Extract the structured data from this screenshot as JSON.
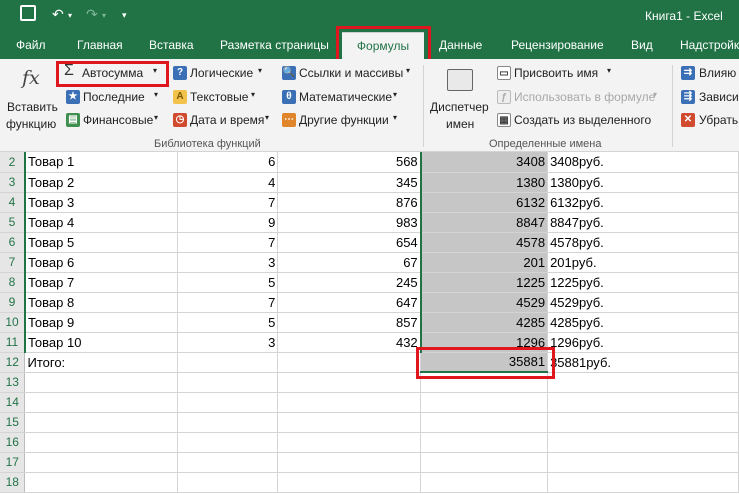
{
  "window": {
    "title": "Книга1 - Excel"
  },
  "tabs": [
    "Файл",
    "Главная",
    "Вставка",
    "Разметка страницы",
    "Формулы",
    "Данные",
    "Рецензирование",
    "Вид",
    "Надстройк"
  ],
  "active_tab": "Формулы",
  "ribbon": {
    "insert_function": {
      "icon": "fx",
      "line1": "Вставить",
      "line2": "функцию"
    },
    "library": {
      "autosum": "Автосумма",
      "recent": "Последние",
      "financial": "Финансовые",
      "logical": "Логические",
      "text": "Текстовые",
      "datetime": "Дата и время",
      "lookup": "Ссылки и массивы",
      "math": "Математические",
      "more": "Другие функции",
      "group_label": "Библиотека функций"
    },
    "names": {
      "manager_line1": "Диспетчер",
      "manager_line2": "имен",
      "define": "Присвоить имя",
      "use_in_formula": "Использовать в формуле",
      "create": "Создать из выделенного",
      "group_label": "Определенные имена"
    },
    "audit": {
      "trace_precedents": "Влияю",
      "trace_dependents": "Зависи",
      "remove": "Убрать"
    }
  },
  "sheet": {
    "rows": [
      {
        "num": "2",
        "a": "Товар 1",
        "b": "6",
        "c": "568",
        "d": "3408",
        "e": "3408руб."
      },
      {
        "num": "3",
        "a": "Товар 2",
        "b": "4",
        "c": "345",
        "d": "1380",
        "e": "1380руб."
      },
      {
        "num": "4",
        "a": "Товар 3",
        "b": "7",
        "c": "876",
        "d": "6132",
        "e": "6132руб."
      },
      {
        "num": "5",
        "a": "Товар 4",
        "b": "9",
        "c": "983",
        "d": "8847",
        "e": "8847руб."
      },
      {
        "num": "6",
        "a": "Товар 5",
        "b": "7",
        "c": "654",
        "d": "4578",
        "e": "4578руб."
      },
      {
        "num": "7",
        "a": "Товар 6",
        "b": "3",
        "c": "67",
        "d": "201",
        "e": "201руб."
      },
      {
        "num": "8",
        "a": "Товар 7",
        "b": "5",
        "c": "245",
        "d": "1225",
        "e": "1225руб."
      },
      {
        "num": "9",
        "a": "Товар 8",
        "b": "7",
        "c": "647",
        "d": "4529",
        "e": "4529руб."
      },
      {
        "num": "10",
        "a": "Товар 9",
        "b": "5",
        "c": "857",
        "d": "4285",
        "e": "4285руб."
      },
      {
        "num": "11",
        "a": "Товар 10",
        "b": "3",
        "c": "432",
        "d": "1296",
        "e": "1296руб."
      },
      {
        "num": "12",
        "a": "Итого:",
        "b": "",
        "c": "",
        "d": "35881",
        "e": "35881руб."
      },
      {
        "num": "13",
        "a": "",
        "b": "",
        "c": "",
        "d": "",
        "e": ""
      },
      {
        "num": "14",
        "a": "",
        "b": "",
        "c": "",
        "d": "",
        "e": ""
      },
      {
        "num": "15",
        "a": "",
        "b": "",
        "c": "",
        "d": "",
        "e": ""
      },
      {
        "num": "16",
        "a": "",
        "b": "",
        "c": "",
        "d": "",
        "e": ""
      },
      {
        "num": "17",
        "a": "",
        "b": "",
        "c": "",
        "d": "",
        "e": ""
      },
      {
        "num": "18",
        "a": "",
        "b": "",
        "c": "",
        "d": "",
        "e": ""
      }
    ]
  },
  "colors": {
    "excel_green": "#217346",
    "highlight_red": "#e0161f",
    "selection_gray": "#c6c6c6"
  }
}
